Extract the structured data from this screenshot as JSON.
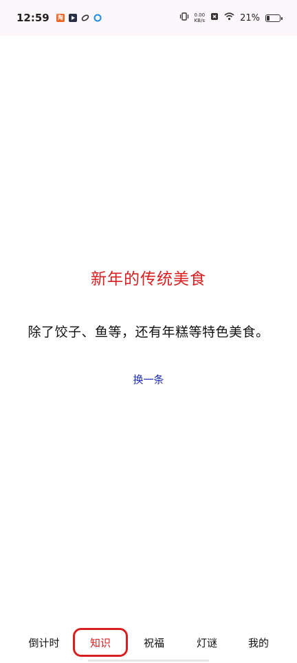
{
  "status_bar": {
    "time": "12:59",
    "net_speed_value": "0.00",
    "net_speed_unit": "KB/s",
    "battery": "21%",
    "battery_level": 0.21
  },
  "content": {
    "title": "新年的传统美食",
    "body": "除了饺子、鱼等，还有年糕等特色美食。",
    "refresh_label": "换一条"
  },
  "nav": {
    "items": [
      {
        "label": "倒计时"
      },
      {
        "label": "知识",
        "active": true
      },
      {
        "label": "祝福"
      },
      {
        "label": "灯谜"
      },
      {
        "label": "我的"
      }
    ]
  },
  "colors": {
    "accent": "#d81e1e",
    "link": "#1d2bb5"
  }
}
